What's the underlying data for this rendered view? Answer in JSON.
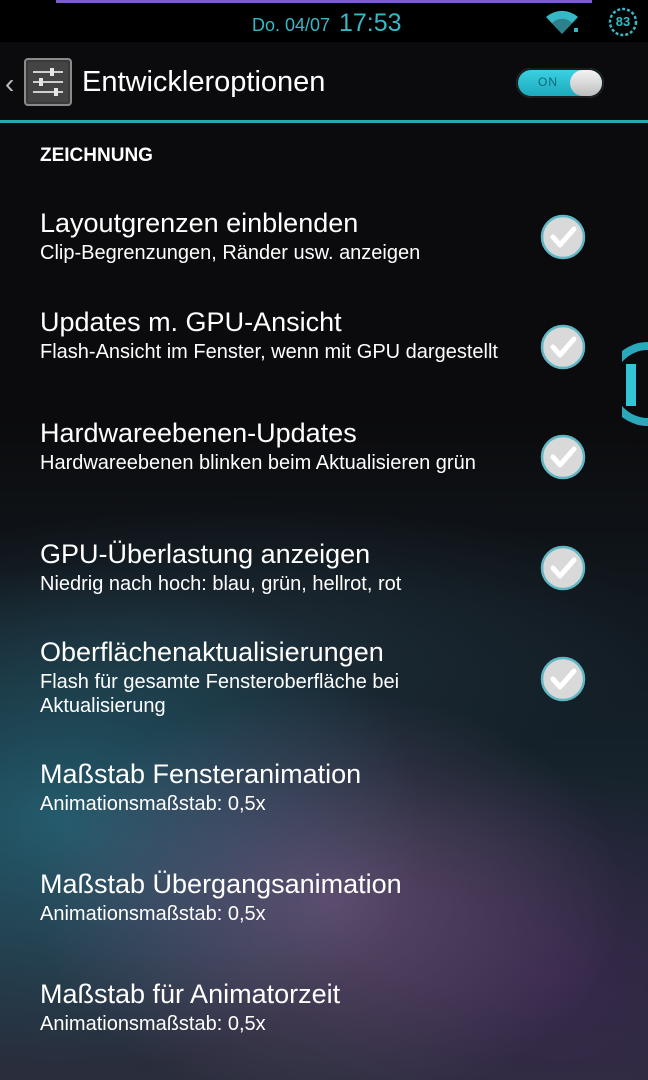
{
  "status_bar": {
    "date": "Do. 04/07",
    "time": "17:53",
    "battery": "83",
    "wifi_icon": "wifi-icon"
  },
  "action_bar": {
    "back_glyph": "‹",
    "title": "Entwickleroptionen",
    "toggle_label": "ON",
    "toggle_state": "on"
  },
  "section_title": "ZEICHNUNG",
  "items": [
    {
      "title": "Layoutgrenzen einblenden",
      "summary": "Clip-Begrenzungen, Ränder usw. anzeigen",
      "checked": true
    },
    {
      "title": "Updates m. GPU-Ansicht",
      "summary": "Flash-Ansicht im Fenster, wenn mit GPU dargestellt",
      "checked": true
    },
    {
      "title": "Hardwareebenen-Updates",
      "summary": "Hardwareebenen blinken beim Aktualisieren grün",
      "checked": true
    },
    {
      "title": "GPU-Überlastung anzeigen",
      "summary": "Niedrig nach hoch: blau, grün, hellrot, rot",
      "checked": true
    },
    {
      "title": "Oberflächenaktualisierungen",
      "summary": "Flash für gesamte Fensteroberfläche bei Aktualisierung",
      "checked": true
    },
    {
      "title": "Maßstab Fensteranimation",
      "summary": "Animationsmaßstab: 0,5x"
    },
    {
      "title": "Maßstab Übergangsanimation",
      "summary": "Animationsmaßstab: 0,5x"
    },
    {
      "title": "Maßstab für Animatorzeit",
      "summary": "Animationsmaßstab: 0,5x"
    }
  ],
  "colors": {
    "accent": "#36b8c6",
    "divider": "#2ba6b6",
    "top_line": "#7b5cc9"
  }
}
